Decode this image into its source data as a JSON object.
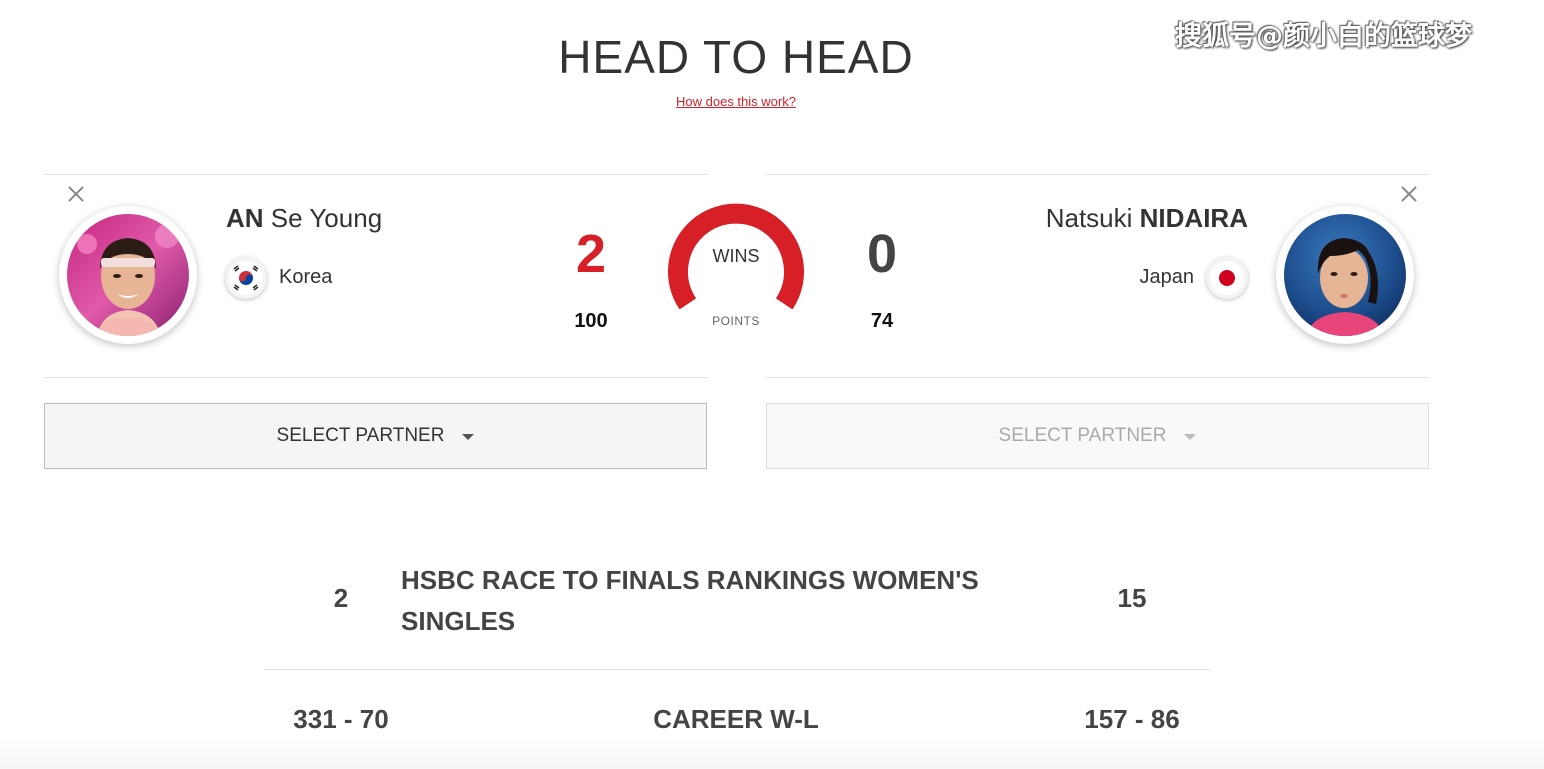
{
  "watermark": "搜狐号@颜小白的篮球梦",
  "header": {
    "title": "HEAD TO HEAD",
    "link": "How does this work?"
  },
  "player1": {
    "surname": "AN",
    "given": "Se Young",
    "country": "Korea",
    "wins": "2",
    "points": "100",
    "select_label": "SELECT PARTNER"
  },
  "player2": {
    "given": "Natsuki",
    "surname": "NIDAIRA",
    "country": "Japan",
    "wins": "0",
    "points": "74",
    "select_label": "SELECT PARTNER"
  },
  "gauge": {
    "wins_label": "WINS",
    "points_label": "POINTS",
    "win_share": 1.0
  },
  "stats": [
    {
      "left": "2",
      "label": "HSBC RACE TO FINALS RANKINGS WOMEN'S SINGLES",
      "right": "15"
    },
    {
      "left": "331 - 70",
      "label": "CAREER W-L",
      "right": "157 - 86"
    }
  ],
  "colors": {
    "accent_red": "#d71f28",
    "text_dark": "#333333"
  },
  "icons": {
    "close": "close-icon",
    "caret": "caret-down-icon",
    "flag1": "korea-flag-icon",
    "flag2": "japan-flag-icon"
  }
}
